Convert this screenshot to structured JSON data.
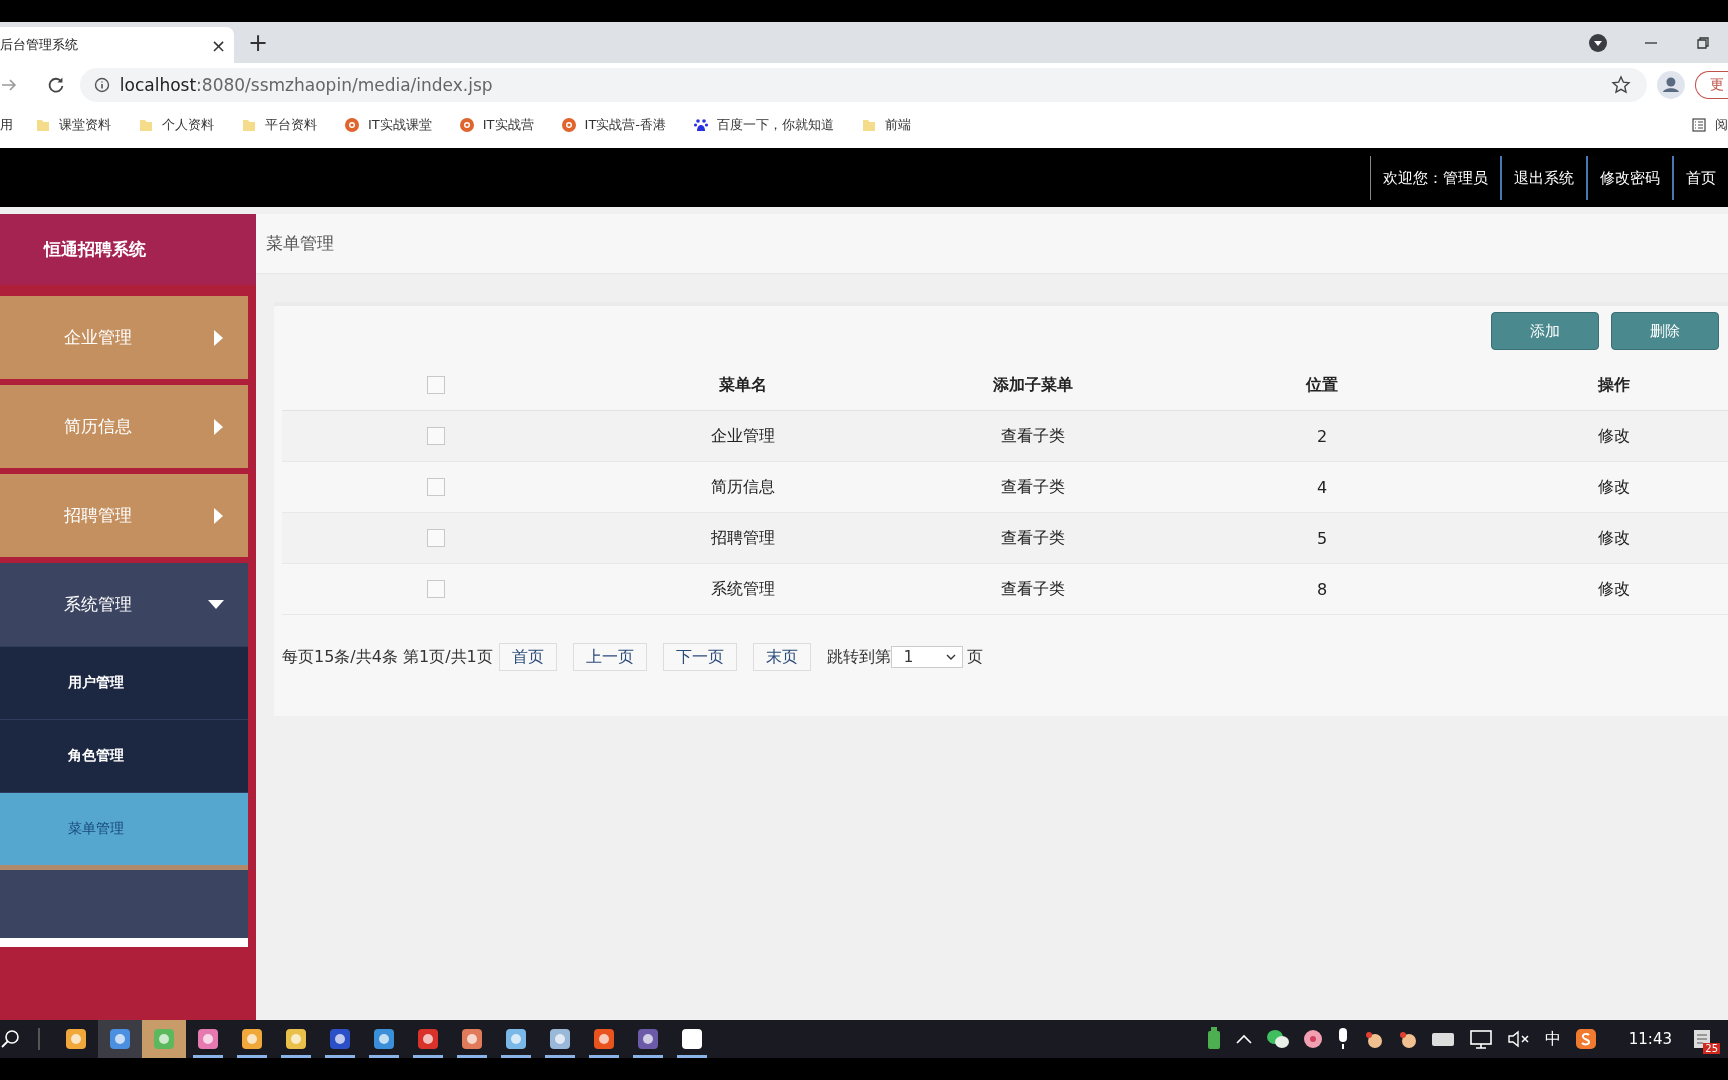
{
  "browser": {
    "tab": {
      "title": "后台管理系统",
      "close": "×"
    },
    "new_tab": "+",
    "url": {
      "host": "localhost",
      "rest": ":8080/ssmzhaopin/media/index.jsp"
    },
    "update_button": "更",
    "bookmarks": [
      {
        "label": "用",
        "kind": "apps"
      },
      {
        "label": "课堂资料",
        "kind": "folder"
      },
      {
        "label": "个人资料",
        "kind": "folder"
      },
      {
        "label": "平台资料",
        "kind": "folder"
      },
      {
        "label": "IT实战课堂",
        "kind": "site"
      },
      {
        "label": "IT实战营",
        "kind": "site"
      },
      {
        "label": "IT实战营-香港",
        "kind": "site"
      },
      {
        "label": "百度一下，你就知道",
        "kind": "paw"
      },
      {
        "label": "前端",
        "kind": "folder"
      }
    ],
    "reader": "阅"
  },
  "header": {
    "links": [
      "欢迎您：管理员",
      "退出系统",
      "修改密码",
      "首页"
    ]
  },
  "sidebar": {
    "title": "恒通招聘系统",
    "menu": [
      {
        "label": "企业管理",
        "expanded": false
      },
      {
        "label": "简历信息",
        "expanded": false
      },
      {
        "label": "招聘管理",
        "expanded": false
      },
      {
        "label": "系统管理",
        "expanded": true,
        "children": [
          {
            "label": "用户管理",
            "selected": false
          },
          {
            "label": "角色管理",
            "selected": false
          },
          {
            "label": "菜单管理",
            "selected": true
          }
        ]
      }
    ]
  },
  "content": {
    "breadcrumb": "菜单管理",
    "buttons": [
      "添加",
      "删除"
    ],
    "table": {
      "columns": [
        "菜单名",
        "添加子菜单",
        "位置",
        "操作"
      ],
      "header_checked": false,
      "rows": [
        {
          "checked": false,
          "cells": [
            "企业管理",
            "查看子类",
            "2",
            "修改"
          ]
        },
        {
          "checked": false,
          "cells": [
            "简历信息",
            "查看子类",
            "4",
            "修改"
          ]
        },
        {
          "checked": false,
          "cells": [
            "招聘管理",
            "查看子类",
            "5",
            "修改"
          ]
        },
        {
          "checked": false,
          "cells": [
            "系统管理",
            "查看子类",
            "8",
            "修改"
          ]
        }
      ]
    },
    "pagination": {
      "summary": "每页15条/共4条 第1页/共1页",
      "buttons": [
        "首页",
        "上一页",
        "下一页",
        "末页"
      ],
      "jump_label": "跳转到第",
      "page_select": "1",
      "page_suffix": "页"
    }
  },
  "taskbar": {
    "ime": "中",
    "time": "11:43",
    "notification_count": "25"
  }
}
